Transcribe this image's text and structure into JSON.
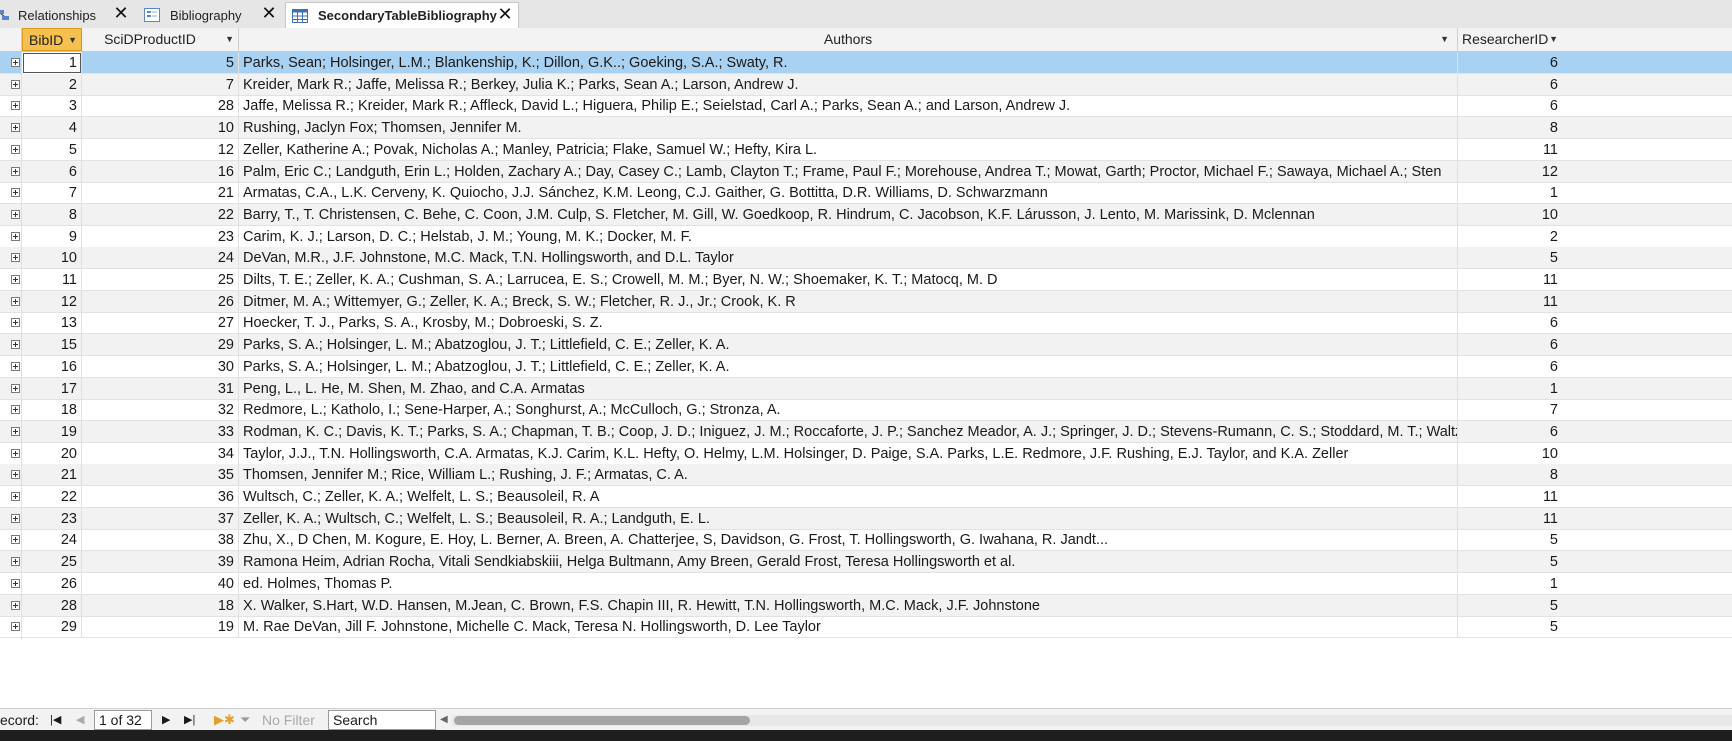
{
  "tabs": [
    {
      "label": "Relationships",
      "icon": "relationships-icon",
      "active": false
    },
    {
      "label": "Bibliography",
      "icon": "form-icon",
      "active": false
    },
    {
      "label": "SecondaryTableBibliography",
      "icon": "table-icon",
      "active": true
    }
  ],
  "columns": [
    {
      "label": "BibID",
      "sort": "dropdown"
    },
    {
      "label": "SciDProductID",
      "sort": "dropdown"
    },
    {
      "label": "Authors",
      "sort": "dropdown"
    },
    {
      "label": "ResearcherID",
      "sort": "dropdown"
    }
  ],
  "rows": [
    {
      "bib": "1",
      "sci": "5",
      "authors": "Parks, Sean; Holsinger, L.M.; Blankenship, K.; Dillon, G.K..; Goeking, S.A.; Swaty, R.",
      "res": "6"
    },
    {
      "bib": "2",
      "sci": "7",
      "authors": "Kreider, Mark R.; Jaffe, Melissa R.; Berkey, Julia K.; Parks, Sean A.; Larson, Andrew J.",
      "res": "6"
    },
    {
      "bib": "3",
      "sci": "28",
      "authors": "Jaffe, Melissa R.; Kreider, Mark R.; Affleck, David L.; Higuera, Philip E.; Seielstad, Carl A.; Parks, Sean A.; and Larson, Andrew J.",
      "res": "6"
    },
    {
      "bib": "4",
      "sci": "10",
      "authors": "Rushing, Jaclyn Fox; Thomsen, Jennifer M.",
      "res": "8"
    },
    {
      "bib": "5",
      "sci": "12",
      "authors": "Zeller, Katherine A.; Povak, Nicholas A.; Manley, Patricia; Flake, Samuel W.; Hefty, Kira L.",
      "res": "11"
    },
    {
      "bib": "6",
      "sci": "16",
      "authors": "Palm, Eric C.; Landguth, Erin L.; Holden, Zachary A.; Day, Casey C.; Lamb, Clayton T.; Frame, Paul F.;   Morehouse, Andrea T.; Mowat, Garth; Proctor, Michael F.; Sawaya, Michael A.; Sten",
      "res": "12"
    },
    {
      "bib": "7",
      "sci": "21",
      "authors": "Armatas, C.A., L.K. Cerveny, K. Quiocho, J.J. Sánchez, K.M. Leong, C.J. Gaither, G. Bottitta, D.R. Williams, D. Schwarzmann",
      "res": "1"
    },
    {
      "bib": "8",
      "sci": "22",
      "authors": "Barry, T., T. Christensen, C. Behe, C. Coon, J.M. Culp, S. Fletcher, M. Gill, W. Goedkoop, R. Hindrum, C. Jacobson, K.F. Lárusson, J. Lento, M. Marissink, D. Mclennan",
      "res": "10"
    },
    {
      "bib": "9",
      "sci": "23",
      "authors": "Carim, K. J.; Larson, D. C.; Helstab, J. M.; Young, M. K.; Docker, M. F.",
      "res": "2"
    },
    {
      "bib": "10",
      "sci": "24",
      "authors": "DeVan, M.R., J.F. Johnstone, M.C. Mack, T.N. Hollingsworth, and D.L. Taylor",
      "res": "5"
    },
    {
      "bib": "11",
      "sci": "25",
      "authors": "Dilts, T. E.; Zeller, K. A.; Cushman, S. A.; Larrucea, E. S.; Crowell, M. M.; Byer, N. W.; Shoemaker, K. T.; Matocq, M. D",
      "res": "11"
    },
    {
      "bib": "12",
      "sci": "26",
      "authors": "Ditmer, M. A.; Wittemyer, G.; Zeller, K. A.; Breck, S. W.; Fletcher, R. J., Jr.; Crook, K. R",
      "res": "11"
    },
    {
      "bib": "13",
      "sci": "27",
      "authors": "Hoecker, T. J., Parks, S. A., Krosby, M.; Dobroeski, S. Z.",
      "res": "6"
    },
    {
      "bib": "15",
      "sci": "29",
      "authors": "Parks, S. A.; Holsinger, L. M.; Abatzoglou, J. T.; Littlefield, C. E.; Zeller, K. A.",
      "res": "6"
    },
    {
      "bib": "16",
      "sci": "30",
      "authors": "Parks, S. A.; Holsinger, L. M.; Abatzoglou, J. T.; Littlefield, C. E.; Zeller, K. A.",
      "res": "6"
    },
    {
      "bib": "17",
      "sci": "31",
      "authors": "Peng, L., L. He, M. Shen, M. Zhao, and C.A. Armatas",
      "res": "1"
    },
    {
      "bib": "18",
      "sci": "32",
      "authors": "Redmore, L.; Katholo, I.; Sene-Harper, A.; Songhurst, A.; McCulloch, G.; Stronza, A.",
      "res": "7"
    },
    {
      "bib": "19",
      "sci": "33",
      "authors": "Rodman, K. C.; Davis, K. T.; Parks, S. A.; Chapman, T. B.; Coop, J. D.; Iniguez, J. M.; Roccaforte, J. P.; Sanchez Meador, A. J.; Springer, J. D.; Stevens-Rumann, C. S.; Stoddard, M. T.; Waltz,",
      "res": "6"
    },
    {
      "bib": "20",
      "sci": "34",
      "authors": "Taylor, J.J., T.N. Hollingsworth, C.A. Armatas, K.J. Carim, K.L. Hefty, O. Helmy, L.M. Holsinger, D. Paige, S.A. Parks, L.E. Redmore, J.F. Rushing, E.J. Taylor, and K.A. Zeller",
      "res": "10"
    },
    {
      "bib": "21",
      "sci": "35",
      "authors": "Thomsen, Jennifer M.; Rice, William L.; Rushing, J. F.; Armatas, C. A.",
      "res": "8"
    },
    {
      "bib": "22",
      "sci": "36",
      "authors": "Wultsch, C.; Zeller, K. A.; Welfelt, L. S.; Beausoleil, R. A",
      "res": "11"
    },
    {
      "bib": "23",
      "sci": "37",
      "authors": "Zeller, K. A.; Wultsch, C.; Welfelt, L. S.; Beausoleil, R. A.; Landguth, E. L.",
      "res": "11"
    },
    {
      "bib": "24",
      "sci": "38",
      "authors": "Zhu, X., D Chen, M. Kogure, E. Hoy, L. Berner, A. Breen, A. Chatterjee, S, Davidson, G. Frost, T. Hollingsworth, G. Iwahana, R. Jandt...",
      "res": "5"
    },
    {
      "bib": "25",
      "sci": "39",
      "authors": "Ramona Heim, Adrian Rocha, Vitali Sendkiabskiii, Helga Bultmann, Amy Breen, Gerald Frost, Teresa Hollingsworth et al.",
      "res": "5"
    },
    {
      "bib": "26",
      "sci": "40",
      "authors": "ed. Holmes, Thomas P.",
      "res": "1"
    },
    {
      "bib": "28",
      "sci": "18",
      "authors": "X. Walker, S.Hart, W.D. Hansen, M.Jean, C. Brown, F.S. Chapin III, R. Hewitt, T.N. Hollingsworth, M.C. Mack, J.F. Johnstone",
      "res": "5"
    },
    {
      "bib": "29",
      "sci": "19",
      "authors": "M. Rae DeVan, Jill F. Johnstone, Michelle C. Mack, Teresa N. Hollingsworth, D. Lee Taylor",
      "res": "5"
    }
  ],
  "navigator": {
    "record_label": "ecord:",
    "position": "1 of 32",
    "filter_label": "No Filter",
    "search_placeholder": "Search"
  },
  "colors": {
    "selected_row": "#a9d1f2",
    "header_selected": "#f5c04d",
    "alt_row": "#f2f2f2"
  }
}
